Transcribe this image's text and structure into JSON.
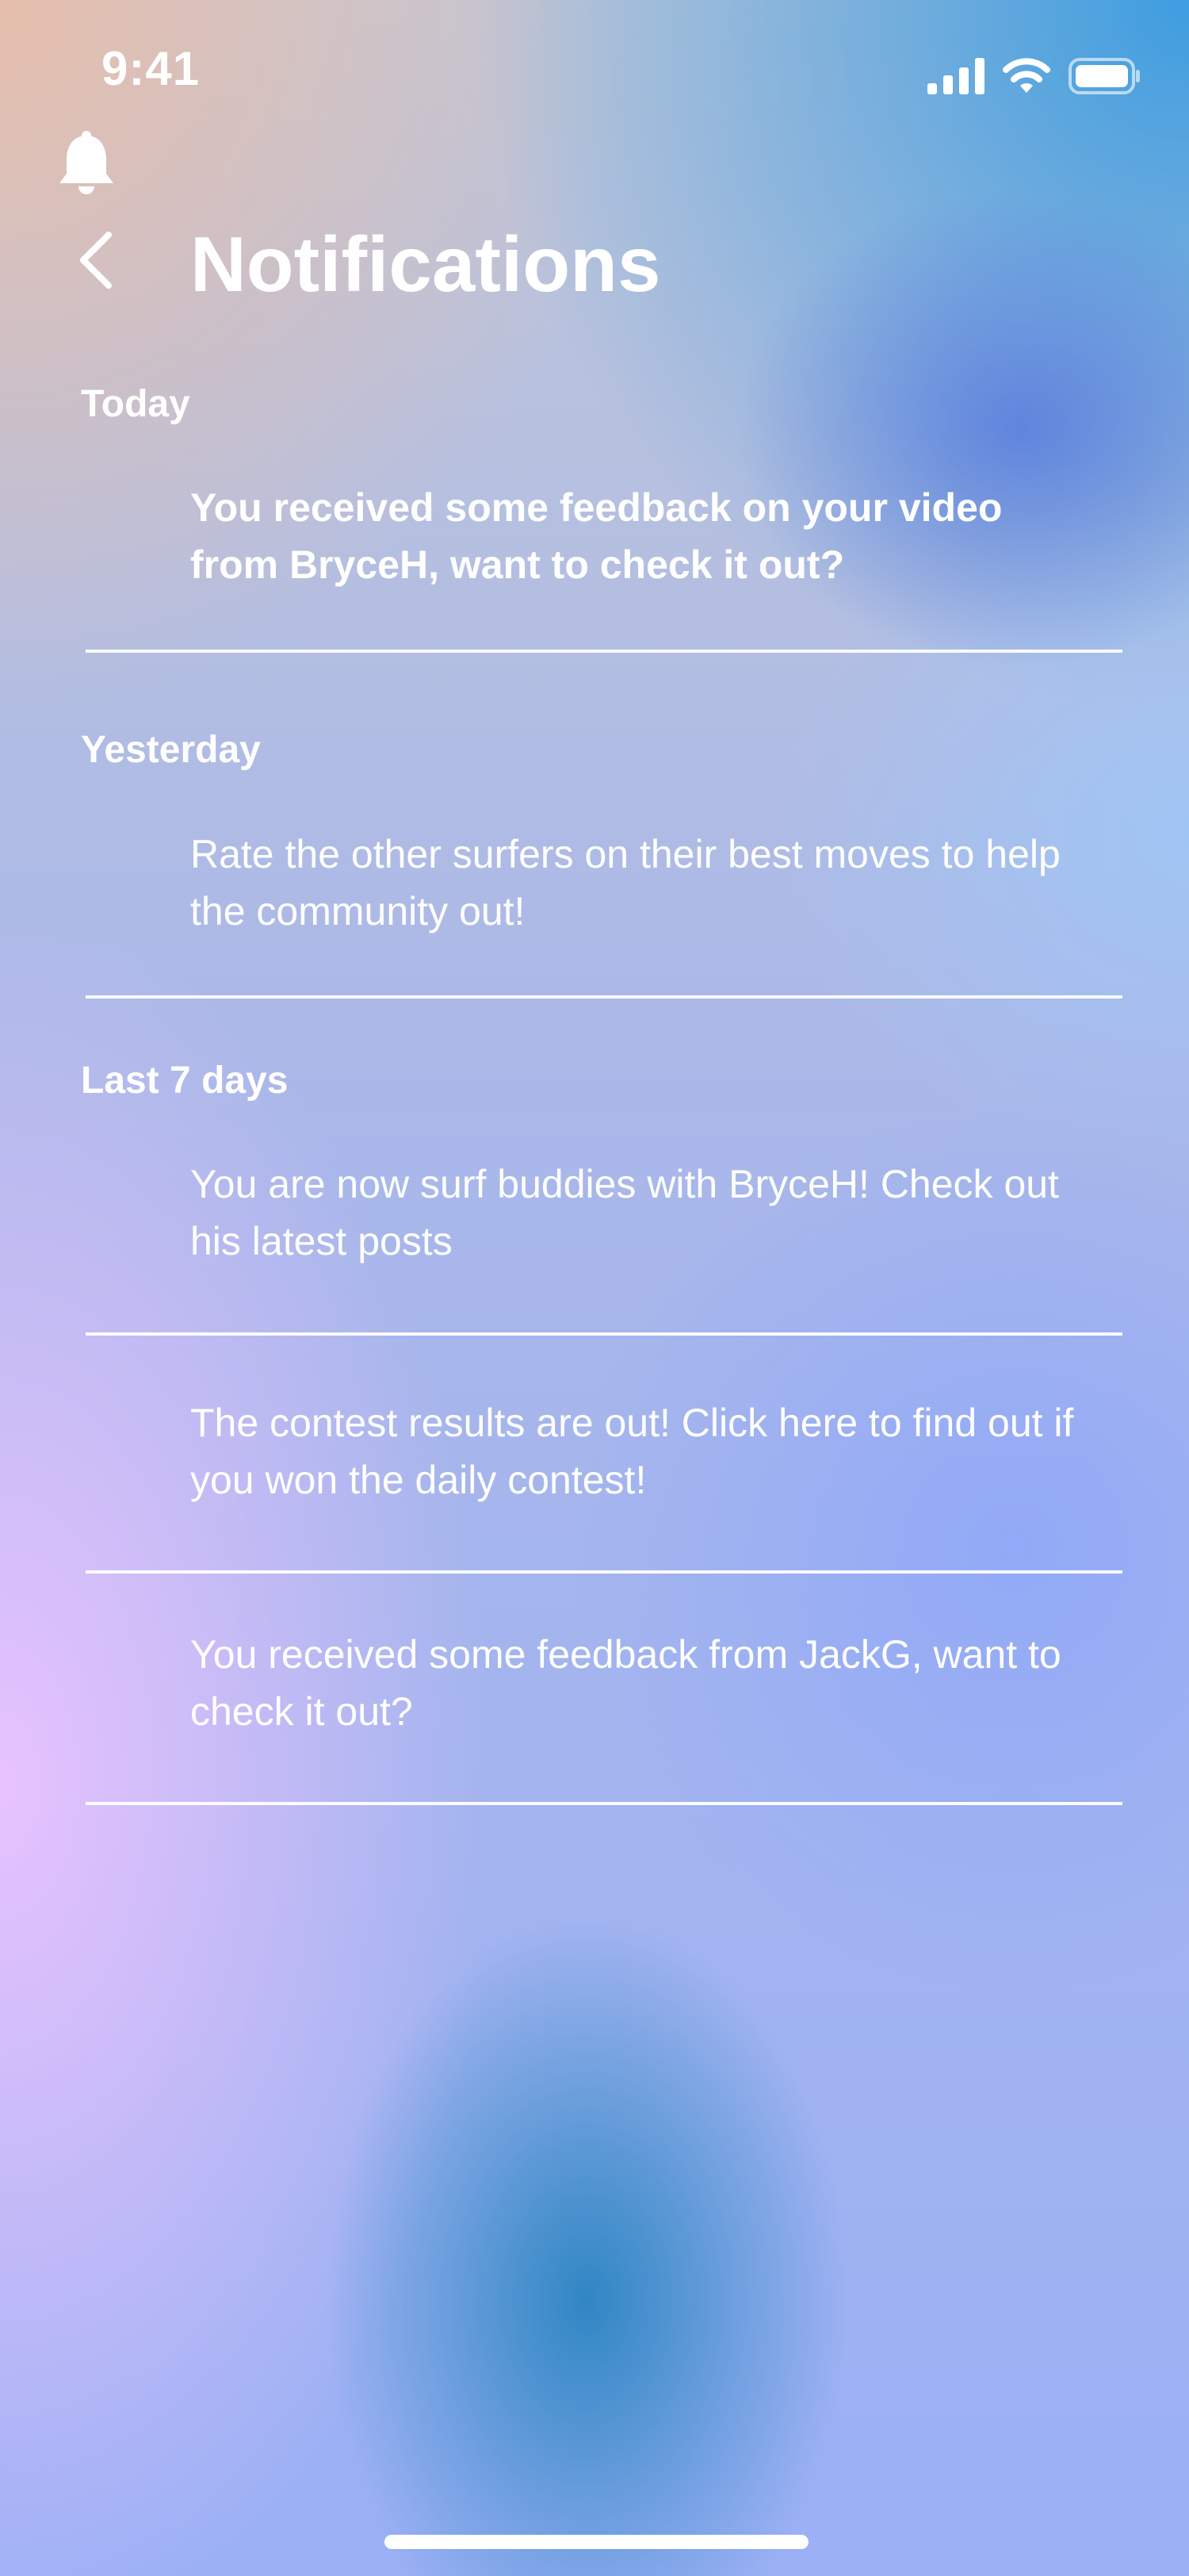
{
  "status_bar": {
    "time": "9:41",
    "icons": [
      "cellular-signal-icon",
      "wifi-icon",
      "battery-icon"
    ]
  },
  "header": {
    "bell_icon": "bell-icon",
    "back_icon": "chevron-left-icon",
    "title": "Notifications"
  },
  "sections": [
    {
      "label": "Today",
      "items": [
        {
          "text": "You received some feedback on your video from BryceH, want to check it out?",
          "unread": true
        }
      ]
    },
    {
      "label": "Yesterday",
      "items": [
        {
          "text": "Rate the other surfers on their best moves to help the community out!",
          "unread": false
        }
      ]
    },
    {
      "label": "Last 7 days",
      "items": [
        {
          "text": "You are now surf buddies with BryceH! Check out his latest posts",
          "unread": false
        },
        {
          "text": "The contest results are out! Click here to find out if you won the daily contest!",
          "unread": false
        },
        {
          "text": "You received some feedback from JackG, want to check it out?",
          "unread": false
        }
      ]
    }
  ],
  "colors": {
    "text": "#ffffff",
    "divider": "#ffffff"
  }
}
